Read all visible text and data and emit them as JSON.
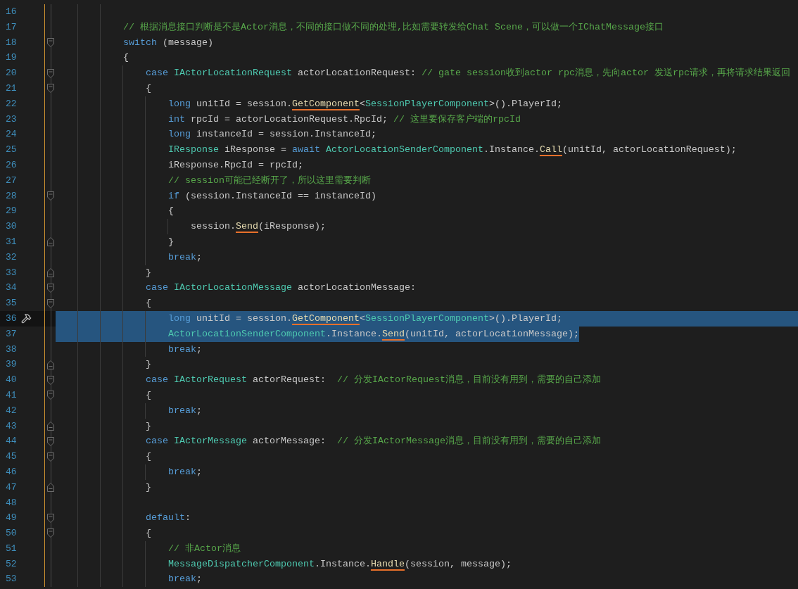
{
  "editor": {
    "lines": [
      {
        "number": "16",
        "current": false,
        "selected": false
      },
      {
        "number": "17",
        "tokens": [
          {
            "kind": "comment",
            "text": "// 根据消息接口判断是不是Actor消息，不同的接口做不同的处理,比如需要转发给Chat Scene，可以做一个IChatMessage接口"
          }
        ],
        "current": false,
        "selected": false
      },
      {
        "number": "18",
        "tokens": [
          {
            "kind": "keyword",
            "text": "switch"
          },
          {
            "kind": "text",
            "text": " (message)"
          }
        ],
        "fold": {
          "kind": "open"
        },
        "current": false,
        "selected": false
      },
      {
        "number": "19",
        "tokens": [
          {
            "kind": "text",
            "text": "{"
          }
        ],
        "current": false,
        "selected": false,
        "children": [
          {
            "number": "20",
            "tokens": [
              {
                "kind": "keyword",
                "text": "case"
              },
              {
                "kind": "type",
                "text": " IActorLocationRequest"
              },
              {
                "kind": "text",
                "text": " actorLocationRequest: "
              },
              {
                "kind": "comment",
                "text": "// gate session收到actor rpc消息，先向actor 发送rpc请求，再将请求结果返回"
              }
            ],
            "fold": {
              "kind": "open"
            },
            "current": false,
            "selected": false
          },
          {
            "number": "21",
            "tokens": [
              {
                "kind": "text",
                "text": "{"
              }
            ],
            "fold": {
              "kind": "open"
            },
            "current": false,
            "selected": false,
            "children": [
              {
                "number": "22",
                "tokens": [
                  {
                    "kind": "keyword",
                    "text": "long"
                  },
                  {
                    "kind": "text",
                    "text": " unitId = session."
                  },
                  {
                    "kind": "call",
                    "text": "GetComponent"
                  },
                  {
                    "kind": "text",
                    "text": "<"
                  },
                  {
                    "kind": "type",
                    "text": "SessionPlayerComponent"
                  },
                  {
                    "kind": "text",
                    "text": ">().PlayerId;"
                  }
                ],
                "current": false,
                "selected": false
              },
              {
                "number": "23",
                "tokens": [
                  {
                    "kind": "keyword",
                    "text": "int"
                  },
                  {
                    "kind": "text",
                    "text": " rpcId = actorLocationRequest.RpcId; "
                  },
                  {
                    "kind": "comment",
                    "text": "// 这里要保存客户端的rpcId"
                  }
                ],
                "current": false,
                "selected": false
              },
              {
                "number": "24",
                "tokens": [
                  {
                    "kind": "keyword",
                    "text": "long"
                  },
                  {
                    "kind": "text",
                    "text": " instanceId = session.InstanceId;"
                  }
                ],
                "current": false,
                "selected": false
              },
              {
                "number": "25",
                "tokens": [
                  {
                    "kind": "type",
                    "text": "IResponse"
                  },
                  {
                    "kind": "text",
                    "text": " iResponse = "
                  },
                  {
                    "kind": "keyword",
                    "text": "await"
                  },
                  {
                    "kind": "type",
                    "text": " ActorLocationSenderComponent"
                  },
                  {
                    "kind": "text",
                    "text": ".Instance."
                  },
                  {
                    "kind": "call",
                    "text": "Call"
                  },
                  {
                    "kind": "text",
                    "text": "(unitId, actorLocationRequest);"
                  }
                ],
                "current": false,
                "selected": false
              },
              {
                "number": "26",
                "tokens": [
                  {
                    "kind": "text",
                    "text": "iResponse.RpcId = rpcId;"
                  }
                ],
                "current": false,
                "selected": false
              },
              {
                "number": "27",
                "tokens": [
                  {
                    "kind": "comment",
                    "text": "// session可能已经断开了，所以这里需要判断"
                  }
                ],
                "current": false,
                "selected": false
              },
              {
                "number": "28",
                "tokens": [
                  {
                    "kind": "keyword",
                    "text": "if"
                  },
                  {
                    "kind": "text",
                    "text": " (session.InstanceId == instanceId)"
                  }
                ],
                "fold": {
                  "kind": "open"
                },
                "current": false,
                "selected": false
              },
              {
                "number": "29",
                "tokens": [
                  {
                    "kind": "text",
                    "text": "{"
                  }
                ],
                "current": false,
                "selected": false,
                "children": [
                  {
                    "number": "30",
                    "tokens": [
                      {
                        "kind": "text",
                        "text": "session."
                      },
                      {
                        "kind": "call",
                        "text": "Send"
                      },
                      {
                        "kind": "text",
                        "text": "(iResponse);"
                      }
                    ],
                    "current": false,
                    "selected": false
                  }
                ]
              },
              {
                "number": "31",
                "tokens": [
                  {
                    "kind": "text",
                    "text": "}"
                  }
                ],
                "fold": {
                  "kind": "close"
                },
                "current": false,
                "selected": false
              },
              {
                "number": "32",
                "tokens": [
                  {
                    "kind": "keyword",
                    "text": "break"
                  },
                  {
                    "kind": "text",
                    "text": ";"
                  }
                ],
                "current": false,
                "selected": false
              }
            ]
          },
          {
            "number": "33",
            "tokens": [
              {
                "kind": "text",
                "text": "}"
              }
            ],
            "fold": {
              "kind": "close"
            },
            "current": false,
            "selected": false
          },
          {
            "number": "34",
            "tokens": [
              {
                "kind": "keyword",
                "text": "case"
              },
              {
                "kind": "type",
                "text": " IActorLocationMessage"
              },
              {
                "kind": "text",
                "text": " actorLocationMessage:"
              }
            ],
            "fold": {
              "kind": "open"
            },
            "current": false,
            "selected": false
          },
          {
            "number": "35",
            "tokens": [
              {
                "kind": "text",
                "text": "{"
              }
            ],
            "fold": {
              "kind": "open"
            },
            "current": false,
            "selected": false,
            "children": [
              {
                "number": "36",
                "tokens": [
                  {
                    "kind": "keyword",
                    "text": "long"
                  },
                  {
                    "kind": "text",
                    "text": " unitId = session."
                  },
                  {
                    "kind": "call",
                    "text": "GetComponent"
                  },
                  {
                    "kind": "text",
                    "text": "<"
                  },
                  {
                    "kind": "type",
                    "text": "SessionPlayerComponent"
                  },
                  {
                    "kind": "text",
                    "text": ">().PlayerId;"
                  }
                ],
                "current": true,
                "selected": true
              },
              {
                "number": "37",
                "tokens": [
                  {
                    "kind": "type",
                    "text": "ActorLocationSenderComponent"
                  },
                  {
                    "kind": "text",
                    "text": ".Instance."
                  },
                  {
                    "kind": "call",
                    "text": "Send"
                  },
                  {
                    "kind": "text",
                    "text": "(unitId, actorLocationMessage);"
                  }
                ],
                "current": false,
                "selected": true
              },
              {
                "number": "38",
                "tokens": [
                  {
                    "kind": "keyword",
                    "text": "break"
                  },
                  {
                    "kind": "text",
                    "text": ";"
                  }
                ],
                "current": false,
                "selected": false
              }
            ]
          },
          {
            "number": "39",
            "tokens": [
              {
                "kind": "text",
                "text": "}"
              }
            ],
            "fold": {
              "kind": "close"
            },
            "current": false,
            "selected": false
          },
          {
            "number": "40",
            "tokens": [
              {
                "kind": "keyword",
                "text": "case"
              },
              {
                "kind": "type",
                "text": " IActorRequest"
              },
              {
                "kind": "text",
                "text": " actorRequest:  "
              },
              {
                "kind": "comment",
                "text": "// 分发IActorRequest消息，目前没有用到，需要的自己添加"
              }
            ],
            "fold": {
              "kind": "open"
            },
            "current": false,
            "selected": false
          },
          {
            "number": "41",
            "tokens": [
              {
                "kind": "text",
                "text": "{"
              }
            ],
            "fold": {
              "kind": "open"
            },
            "current": false,
            "selected": false,
            "children": [
              {
                "number": "42",
                "tokens": [
                  {
                    "kind": "keyword",
                    "text": "break"
                  },
                  {
                    "kind": "text",
                    "text": ";"
                  }
                ],
                "current": false,
                "selected": false
              }
            ]
          },
          {
            "number": "43",
            "tokens": [
              {
                "kind": "text",
                "text": "}"
              }
            ],
            "fold": {
              "kind": "close"
            },
            "current": false,
            "selected": false
          },
          {
            "number": "44",
            "tokens": [
              {
                "kind": "keyword",
                "text": "case"
              },
              {
                "kind": "type",
                "text": " IActorMessage"
              },
              {
                "kind": "text",
                "text": " actorMessage:  "
              },
              {
                "kind": "comment",
                "text": "// 分发IActorMessage消息，目前没有用到，需要的自己添加"
              }
            ],
            "fold": {
              "kind": "open"
            },
            "current": false,
            "selected": false
          },
          {
            "number": "45",
            "tokens": [
              {
                "kind": "text",
                "text": "{"
              }
            ],
            "fold": {
              "kind": "open"
            },
            "current": false,
            "selected": false,
            "children": [
              {
                "number": "46",
                "tokens": [
                  {
                    "kind": "keyword",
                    "text": "break"
                  },
                  {
                    "kind": "text",
                    "text": ";"
                  }
                ],
                "current": false,
                "selected": false
              }
            ]
          },
          {
            "number": "47",
            "tokens": [
              {
                "kind": "text",
                "text": "}"
              }
            ],
            "fold": {
              "kind": "close"
            },
            "current": false,
            "selected": false
          },
          {
            "number": "48",
            "current": false,
            "selected": false
          },
          {
            "number": "49",
            "tokens": [
              {
                "kind": "keyword",
                "text": "default"
              },
              {
                "kind": "text",
                "text": ":"
              }
            ],
            "fold": {
              "kind": "open"
            },
            "current": false,
            "selected": false
          },
          {
            "number": "50",
            "tokens": [
              {
                "kind": "text",
                "text": "{"
              }
            ],
            "fold": {
              "kind": "open"
            },
            "current": false,
            "selected": false,
            "children": [
              {
                "number": "51",
                "tokens": [
                  {
                    "kind": "comment",
                    "text": "// 非Actor消息"
                  }
                ],
                "current": false,
                "selected": false
              },
              {
                "number": "52",
                "tokens": [
                  {
                    "kind": "type",
                    "text": "MessageDispatcherComponent"
                  },
                  {
                    "kind": "text",
                    "text": ".Instance."
                  },
                  {
                    "kind": "call",
                    "text": "Handle"
                  },
                  {
                    "kind": "text",
                    "text": "(session, message);"
                  }
                ],
                "current": false,
                "selected": false
              },
              {
                "number": "53",
                "tokens": [
                  {
                    "kind": "keyword",
                    "text": "break"
                  },
                  {
                    "kind": "text",
                    "text": ";"
                  }
                ],
                "current": false,
                "selected": false
              }
            ]
          }
        ]
      }
    ]
  }
}
